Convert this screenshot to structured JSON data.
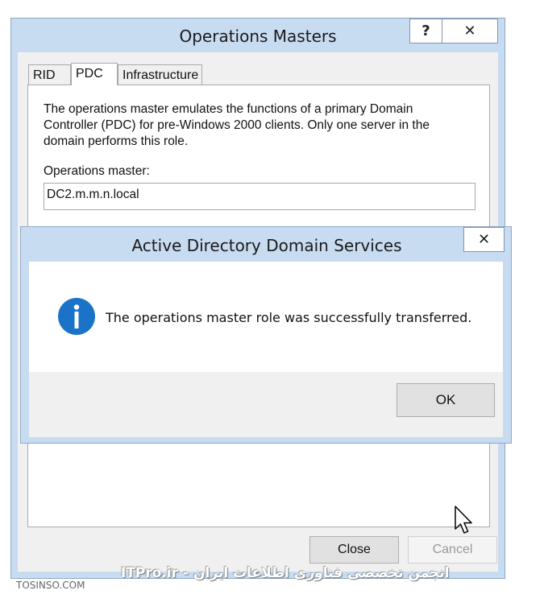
{
  "dialog": {
    "title": "Operations Masters",
    "help_button": "?",
    "close_button": "✕",
    "tabs": [
      {
        "label": "RID",
        "active": false
      },
      {
        "label": "PDC",
        "active": true
      },
      {
        "label": "Infrastructure",
        "active": false
      }
    ],
    "description": "The operations master emulates the functions of a primary Domain Controller (PDC) for pre-Windows 2000 clients. Only one server in the domain performs this role.",
    "operations_master_label": "Operations master:",
    "operations_master_value": "DC2.m.m.n.local",
    "close_label": "Close",
    "cancel_label": "Cancel"
  },
  "message_box": {
    "title": "Active Directory Domain Services",
    "close_button": "✕",
    "icon": "info-icon",
    "message": "The operations master role was successfully transferred.",
    "ok_label": "OK"
  },
  "watermarks": {
    "left": "TOSINSO.COM",
    "center": "انجمن تخصصی فناوری اطلاعات ایران - ITPro.ir"
  },
  "colors": {
    "frame": "#c7dbf1",
    "info_blue": "#1a73c8"
  }
}
